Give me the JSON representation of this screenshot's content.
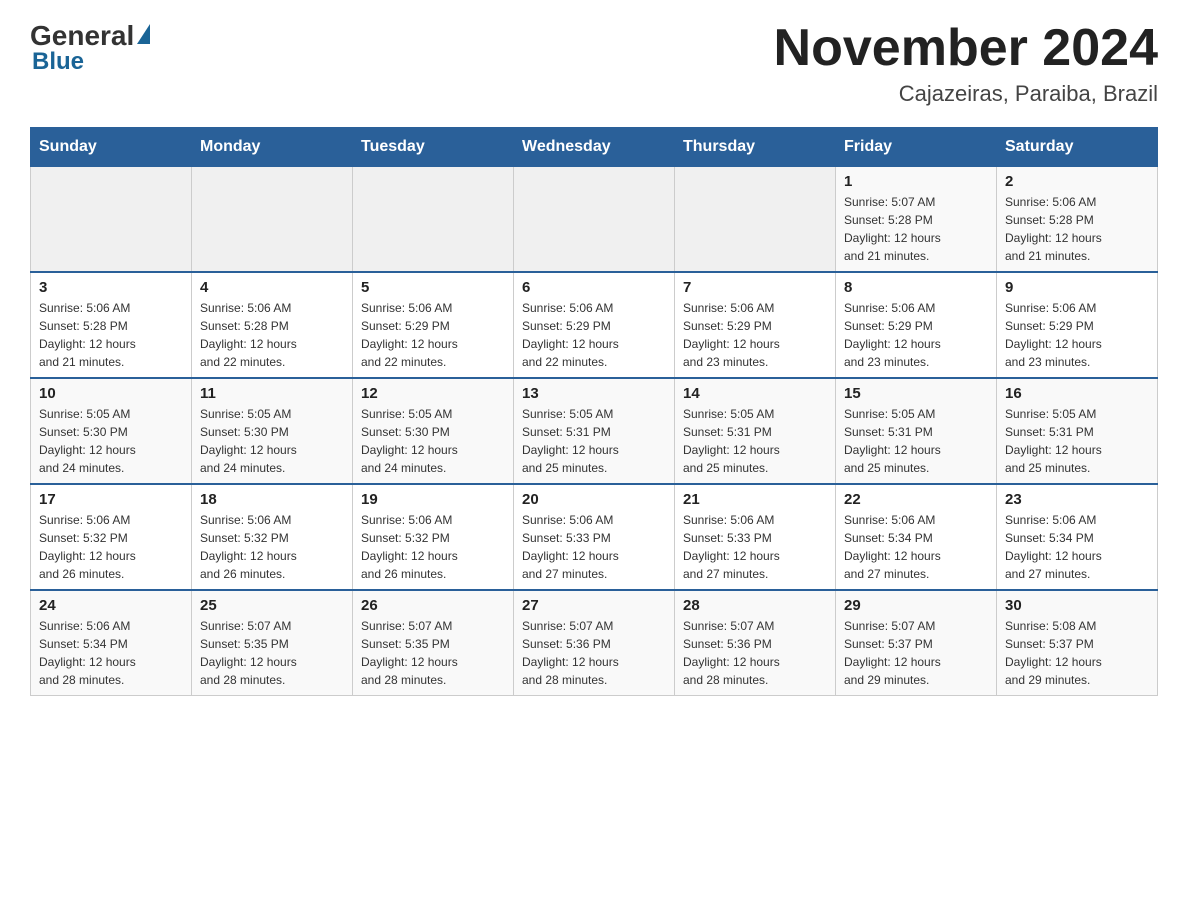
{
  "header": {
    "logo_general": "General",
    "logo_blue": "Blue",
    "month_title": "November 2024",
    "subtitle": "Cajazeiras, Paraiba, Brazil"
  },
  "weekdays": [
    "Sunday",
    "Monday",
    "Tuesday",
    "Wednesday",
    "Thursday",
    "Friday",
    "Saturday"
  ],
  "weeks": [
    {
      "days": [
        {
          "number": "",
          "info": ""
        },
        {
          "number": "",
          "info": ""
        },
        {
          "number": "",
          "info": ""
        },
        {
          "number": "",
          "info": ""
        },
        {
          "number": "",
          "info": ""
        },
        {
          "number": "1",
          "info": "Sunrise: 5:07 AM\nSunset: 5:28 PM\nDaylight: 12 hours\nand 21 minutes."
        },
        {
          "number": "2",
          "info": "Sunrise: 5:06 AM\nSunset: 5:28 PM\nDaylight: 12 hours\nand 21 minutes."
        }
      ]
    },
    {
      "days": [
        {
          "number": "3",
          "info": "Sunrise: 5:06 AM\nSunset: 5:28 PM\nDaylight: 12 hours\nand 21 minutes."
        },
        {
          "number": "4",
          "info": "Sunrise: 5:06 AM\nSunset: 5:28 PM\nDaylight: 12 hours\nand 22 minutes."
        },
        {
          "number": "5",
          "info": "Sunrise: 5:06 AM\nSunset: 5:29 PM\nDaylight: 12 hours\nand 22 minutes."
        },
        {
          "number": "6",
          "info": "Sunrise: 5:06 AM\nSunset: 5:29 PM\nDaylight: 12 hours\nand 22 minutes."
        },
        {
          "number": "7",
          "info": "Sunrise: 5:06 AM\nSunset: 5:29 PM\nDaylight: 12 hours\nand 23 minutes."
        },
        {
          "number": "8",
          "info": "Sunrise: 5:06 AM\nSunset: 5:29 PM\nDaylight: 12 hours\nand 23 minutes."
        },
        {
          "number": "9",
          "info": "Sunrise: 5:06 AM\nSunset: 5:29 PM\nDaylight: 12 hours\nand 23 minutes."
        }
      ]
    },
    {
      "days": [
        {
          "number": "10",
          "info": "Sunrise: 5:05 AM\nSunset: 5:30 PM\nDaylight: 12 hours\nand 24 minutes."
        },
        {
          "number": "11",
          "info": "Sunrise: 5:05 AM\nSunset: 5:30 PM\nDaylight: 12 hours\nand 24 minutes."
        },
        {
          "number": "12",
          "info": "Sunrise: 5:05 AM\nSunset: 5:30 PM\nDaylight: 12 hours\nand 24 minutes."
        },
        {
          "number": "13",
          "info": "Sunrise: 5:05 AM\nSunset: 5:31 PM\nDaylight: 12 hours\nand 25 minutes."
        },
        {
          "number": "14",
          "info": "Sunrise: 5:05 AM\nSunset: 5:31 PM\nDaylight: 12 hours\nand 25 minutes."
        },
        {
          "number": "15",
          "info": "Sunrise: 5:05 AM\nSunset: 5:31 PM\nDaylight: 12 hours\nand 25 minutes."
        },
        {
          "number": "16",
          "info": "Sunrise: 5:05 AM\nSunset: 5:31 PM\nDaylight: 12 hours\nand 25 minutes."
        }
      ]
    },
    {
      "days": [
        {
          "number": "17",
          "info": "Sunrise: 5:06 AM\nSunset: 5:32 PM\nDaylight: 12 hours\nand 26 minutes."
        },
        {
          "number": "18",
          "info": "Sunrise: 5:06 AM\nSunset: 5:32 PM\nDaylight: 12 hours\nand 26 minutes."
        },
        {
          "number": "19",
          "info": "Sunrise: 5:06 AM\nSunset: 5:32 PM\nDaylight: 12 hours\nand 26 minutes."
        },
        {
          "number": "20",
          "info": "Sunrise: 5:06 AM\nSunset: 5:33 PM\nDaylight: 12 hours\nand 27 minutes."
        },
        {
          "number": "21",
          "info": "Sunrise: 5:06 AM\nSunset: 5:33 PM\nDaylight: 12 hours\nand 27 minutes."
        },
        {
          "number": "22",
          "info": "Sunrise: 5:06 AM\nSunset: 5:34 PM\nDaylight: 12 hours\nand 27 minutes."
        },
        {
          "number": "23",
          "info": "Sunrise: 5:06 AM\nSunset: 5:34 PM\nDaylight: 12 hours\nand 27 minutes."
        }
      ]
    },
    {
      "days": [
        {
          "number": "24",
          "info": "Sunrise: 5:06 AM\nSunset: 5:34 PM\nDaylight: 12 hours\nand 28 minutes."
        },
        {
          "number": "25",
          "info": "Sunrise: 5:07 AM\nSunset: 5:35 PM\nDaylight: 12 hours\nand 28 minutes."
        },
        {
          "number": "26",
          "info": "Sunrise: 5:07 AM\nSunset: 5:35 PM\nDaylight: 12 hours\nand 28 minutes."
        },
        {
          "number": "27",
          "info": "Sunrise: 5:07 AM\nSunset: 5:36 PM\nDaylight: 12 hours\nand 28 minutes."
        },
        {
          "number": "28",
          "info": "Sunrise: 5:07 AM\nSunset: 5:36 PM\nDaylight: 12 hours\nand 28 minutes."
        },
        {
          "number": "29",
          "info": "Sunrise: 5:07 AM\nSunset: 5:37 PM\nDaylight: 12 hours\nand 29 minutes."
        },
        {
          "number": "30",
          "info": "Sunrise: 5:08 AM\nSunset: 5:37 PM\nDaylight: 12 hours\nand 29 minutes."
        }
      ]
    }
  ]
}
